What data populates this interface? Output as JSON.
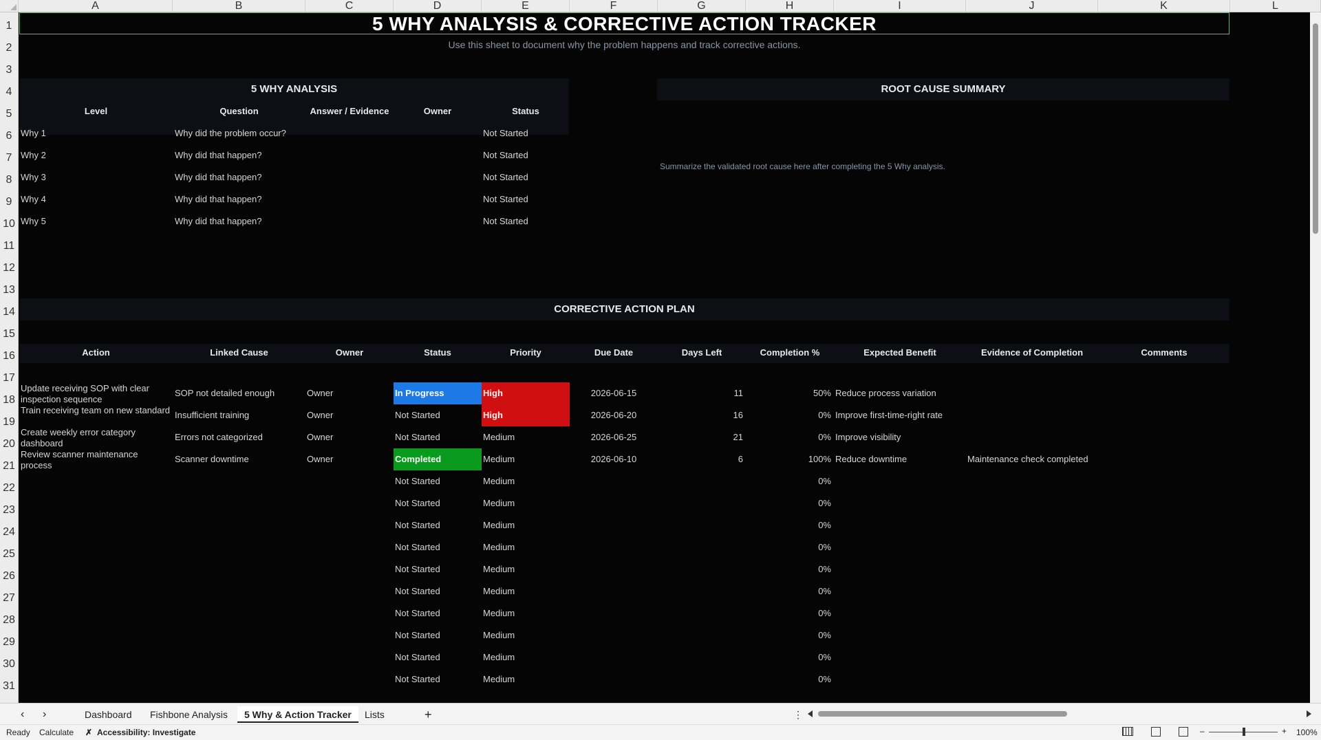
{
  "columns": [
    "A",
    "B",
    "C",
    "D",
    "E",
    "F",
    "G",
    "H",
    "I",
    "J",
    "K",
    "L"
  ],
  "rows": [
    "1",
    "2",
    "3",
    "4",
    "5",
    "6",
    "7",
    "8",
    "9",
    "10",
    "11",
    "12",
    "13",
    "14",
    "15",
    "16",
    "17",
    "18",
    "19",
    "20",
    "21",
    "22",
    "23",
    "24",
    "25",
    "26",
    "27",
    "28",
    "29",
    "30",
    "31"
  ],
  "title": "5 WHY ANALYSIS & CORRECTIVE ACTION TRACKER",
  "subtitle": "Use this sheet to document why the problem happens and track corrective actions.",
  "why_section": {
    "heading": "5 WHY ANALYSIS",
    "headers": [
      "Level",
      "Question",
      "Answer / Evidence",
      "Owner",
      "Status"
    ],
    "rows": [
      {
        "level": "Why 1",
        "question": "Why did the problem occur?",
        "status": "Not Started"
      },
      {
        "level": "Why 2",
        "question": "Why did that happen?",
        "status": "Not Started"
      },
      {
        "level": "Why 3",
        "question": "Why did that happen?",
        "status": "Not Started"
      },
      {
        "level": "Why 4",
        "question": "Why did that happen?",
        "status": "Not Started"
      },
      {
        "level": "Why 5",
        "question": "Why did that happen?",
        "status": "Not Started"
      }
    ]
  },
  "root_cause": {
    "heading": "ROOT CAUSE SUMMARY",
    "placeholder": "Summarize the validated root cause here after completing the 5 Why analysis."
  },
  "action_plan": {
    "heading": "CORRECTIVE ACTION PLAN",
    "headers": [
      "Action",
      "Linked Cause",
      "Owner",
      "Status",
      "Priority",
      "Due Date",
      "Days Left",
      "Completion %",
      "Expected Benefit",
      "Evidence of Completion",
      "Comments"
    ],
    "rows": [
      {
        "action": "Update receiving SOP with clear inspection sequence",
        "cause": "SOP not detailed enough",
        "owner": "Owner",
        "status": "In Progress",
        "priority": "High",
        "due": "2026-06-15",
        "days": "11",
        "pct": "50%",
        "benefit": "Reduce process variation",
        "evidence": ""
      },
      {
        "action": "Train receiving team on new standard",
        "cause": "Insufficient training",
        "owner": "Owner",
        "status": "Not Started",
        "priority": "High",
        "due": "2026-06-20",
        "days": "16",
        "pct": "0%",
        "benefit": "Improve first-time-right rate",
        "evidence": ""
      },
      {
        "action": "Create weekly error category dashboard",
        "cause": "Errors not categorized",
        "owner": "Owner",
        "status": "Not Started",
        "priority": "Medium",
        "due": "2026-06-25",
        "days": "21",
        "pct": "0%",
        "benefit": "Improve visibility",
        "evidence": ""
      },
      {
        "action": "Review scanner maintenance process",
        "cause": "Scanner downtime",
        "owner": "Owner",
        "status": "Completed",
        "priority": "Medium",
        "due": "2026-06-10",
        "days": "6",
        "pct": "100%",
        "benefit": "Reduce downtime",
        "evidence": "Maintenance check completed"
      },
      {
        "status": "Not Started",
        "priority": "Medium",
        "pct": "0%"
      },
      {
        "status": "Not Started",
        "priority": "Medium",
        "pct": "0%"
      },
      {
        "status": "Not Started",
        "priority": "Medium",
        "pct": "0%"
      },
      {
        "status": "Not Started",
        "priority": "Medium",
        "pct": "0%"
      },
      {
        "status": "Not Started",
        "priority": "Medium",
        "pct": "0%"
      },
      {
        "status": "Not Started",
        "priority": "Medium",
        "pct": "0%"
      },
      {
        "status": "Not Started",
        "priority": "Medium",
        "pct": "0%"
      },
      {
        "status": "Not Started",
        "priority": "Medium",
        "pct": "0%"
      },
      {
        "status": "Not Started",
        "priority": "Medium",
        "pct": "0%"
      },
      {
        "status": "Not Started",
        "priority": "Medium",
        "pct": "0%"
      }
    ]
  },
  "colors": {
    "in_progress": "#1d79e6",
    "high": "#d01010",
    "completed": "#0a9a1e"
  },
  "tabs": [
    "Dashboard",
    "Fishbone Analysis",
    "5 Why & Action Tracker",
    "Lists"
  ],
  "active_tab": "5 Why & Action Tracker",
  "icons": {
    "prev": "chevron-left-icon",
    "next": "chevron-right-icon",
    "add": "plus-icon",
    "more": "vertical-ellipsis-icon"
  },
  "status_bar": {
    "ready": "Ready",
    "calculate": "Calculate",
    "accessibility": "Accessibility: Investigate",
    "zoom": "100%"
  }
}
